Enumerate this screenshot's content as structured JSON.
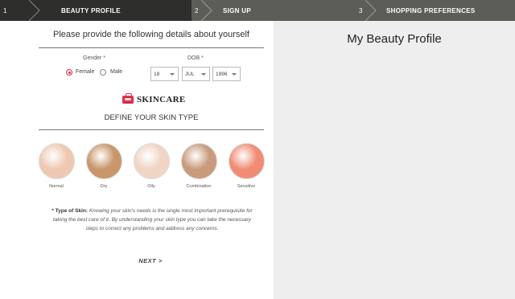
{
  "stepper": {
    "steps": [
      {
        "number": "1",
        "label": "BEAUTY PROFILE"
      },
      {
        "number": "2",
        "label": "SIGN UP"
      },
      {
        "number": "3",
        "label": "SHOPPING PREFERENCES"
      }
    ]
  },
  "form": {
    "intro": "Please provide the following details about yourself",
    "gender_label": "Gender",
    "required_mark": "*",
    "gender_options": [
      "Female",
      "Male"
    ],
    "gender_selected": "Female",
    "dob_label": "DOB",
    "dob": {
      "day": "18",
      "month": "JUL",
      "year": "1996"
    },
    "section_title": "SKINCARE",
    "section_subtitle": "DEFINE YOUR SKIN TYPE",
    "skin_types": [
      {
        "label": "Normal",
        "color": "#efc8b2"
      },
      {
        "label": "Dry",
        "color": "#c8966a"
      },
      {
        "label": "Oily",
        "color": "#f0d4c4"
      },
      {
        "label": "Combination",
        "color": "#c99a7c"
      },
      {
        "label": "Sensitive",
        "color": "#f08c74"
      }
    ],
    "type_of_skin_label": "* Type of Skin:",
    "type_of_skin_text": "Knowing your skin's needs is the single most important prerequisite for taking the best care of it. By understanding your skin type you can take the necessary steps to correct any problems and address any concerns.",
    "next_label": "NEXT >"
  },
  "right_panel": {
    "title": "My Beauty Profile"
  },
  "colors": {
    "accent": "#d9304a",
    "stepper_active": "#2e2e2c",
    "stepper_inactive": "#5c5c58",
    "right_panel_bg": "#eeeeee"
  }
}
